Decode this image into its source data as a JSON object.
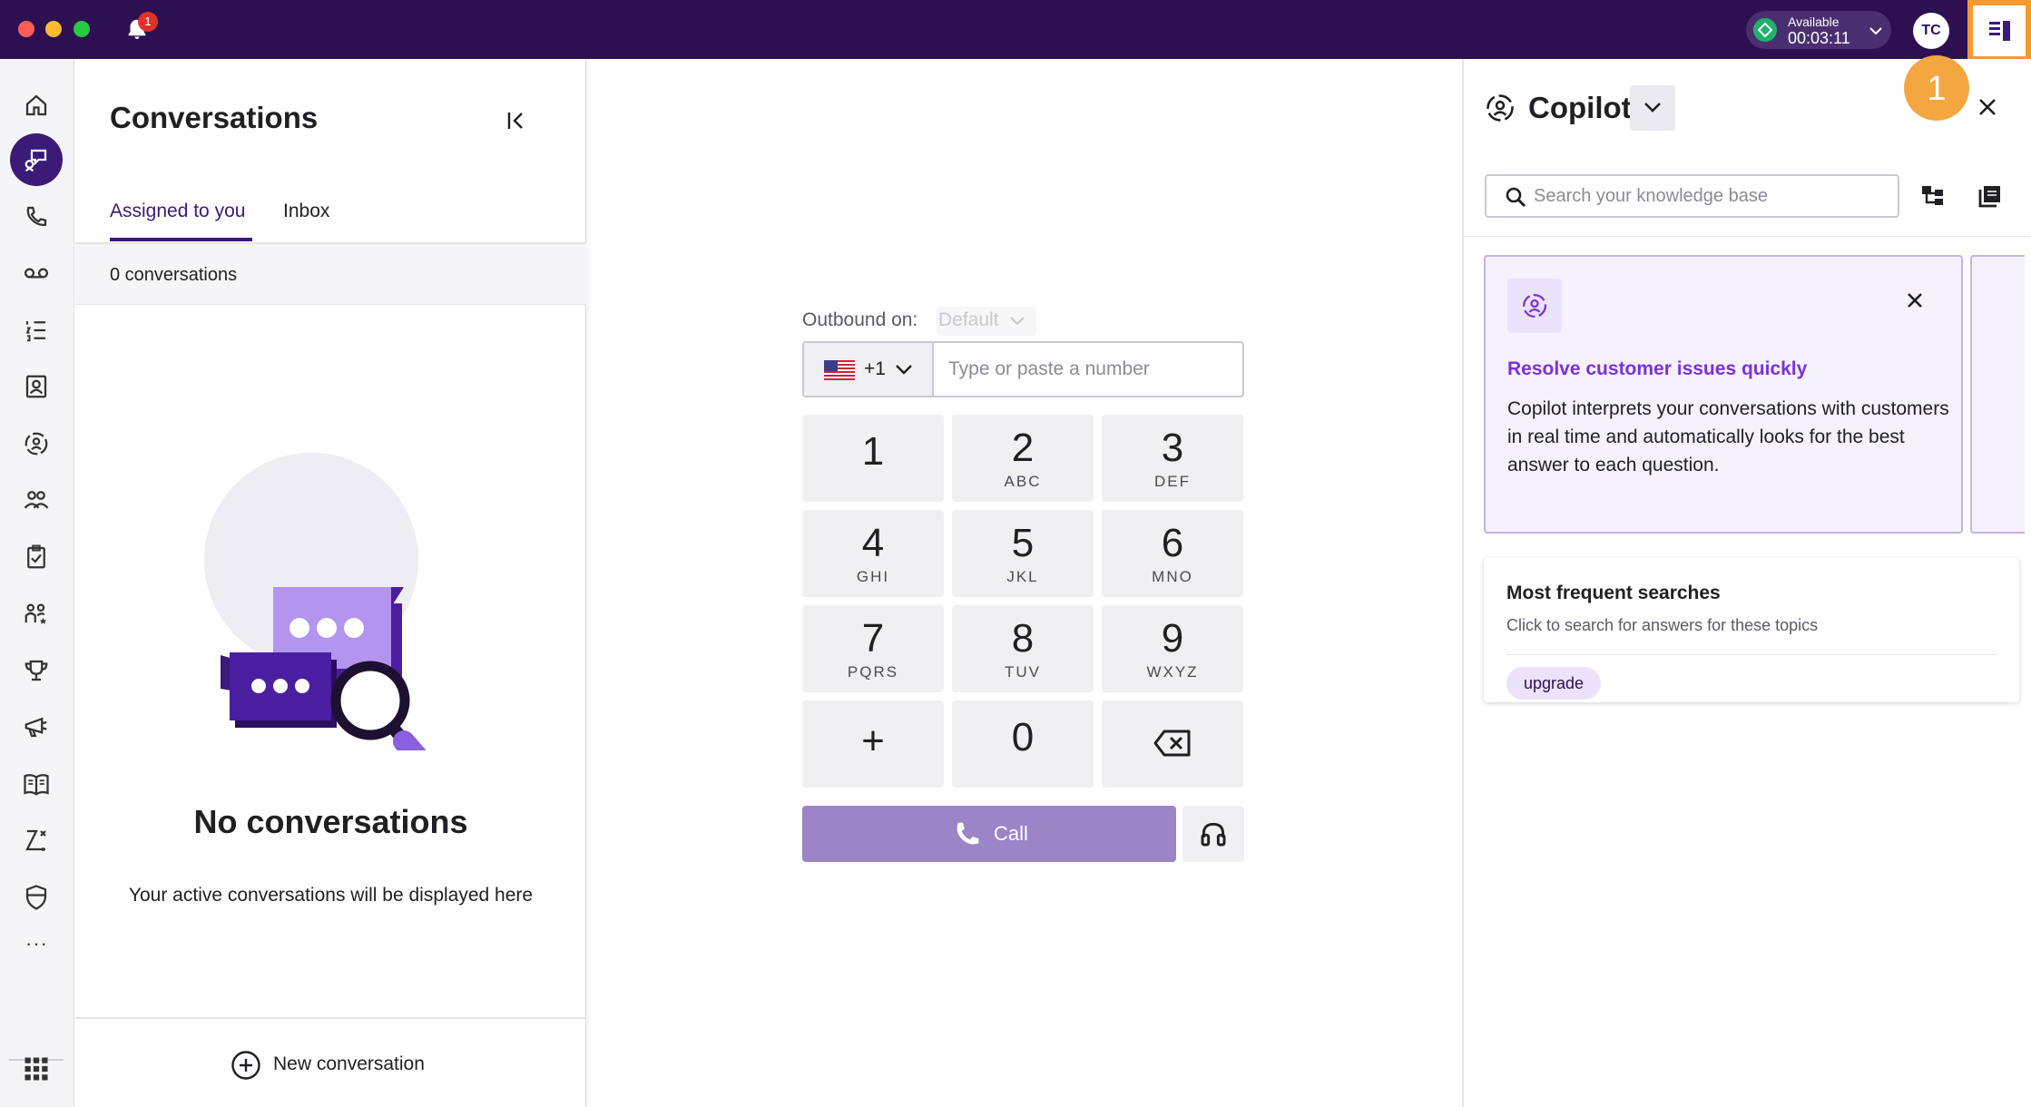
{
  "topbar": {
    "notification_count": "1",
    "status_label": "Available",
    "status_time": "00:03:11",
    "avatar_initials": "TC",
    "step_number": "1",
    "colors": {
      "background": "#2c1052",
      "highlight": "#f49a2c",
      "status": "#1fb26b"
    }
  },
  "rail": {
    "items": [
      "home-icon",
      "conversations-icon",
      "calls-icon",
      "voicemail-icon",
      "queue-list-icon",
      "contacts-icon",
      "copilot-icon",
      "team-icon",
      "tasks-icon",
      "agents-icon",
      "trophy-icon",
      "campaigns-icon",
      "knowledge-book-icon",
      "workflows-icon",
      "security-shield-icon"
    ],
    "more_label": "···",
    "apps_icon": "apps-grid-icon"
  },
  "conversations": {
    "title": "Conversations",
    "tabs": [
      "Assigned to you",
      "Inbox"
    ],
    "count_text": "0 conversations",
    "empty_title": "No conversations",
    "empty_subtitle": "Your active conversations will be displayed here",
    "new_conversation_label": "New conversation"
  },
  "dialer": {
    "outbound_label": "Outbound on:",
    "outbound_value": "Default",
    "country_code": "+1",
    "phone_placeholder": "Type or paste a number",
    "keys": [
      {
        "num": "1",
        "letters": ""
      },
      {
        "num": "2",
        "letters": "ABC"
      },
      {
        "num": "3",
        "letters": "DEF"
      },
      {
        "num": "4",
        "letters": "GHI"
      },
      {
        "num": "5",
        "letters": "JKL"
      },
      {
        "num": "6",
        "letters": "MNO"
      },
      {
        "num": "7",
        "letters": "PQRS"
      },
      {
        "num": "8",
        "letters": "TUV"
      },
      {
        "num": "9",
        "letters": "WXYZ"
      },
      {
        "num": "+",
        "letters": ""
      },
      {
        "num": "0",
        "letters": ""
      },
      {
        "num": "",
        "letters": ""
      }
    ],
    "call_label": "Call",
    "colors": {
      "call_button": "#9b85c7"
    }
  },
  "copilot": {
    "title": "Copilot",
    "search_placeholder": "Search your knowledge base",
    "tip": {
      "title": "Resolve customer issues quickly",
      "body": "Copilot interprets your conversations with customers in real time and automatically looks for the best answer to each question."
    },
    "frequent": {
      "title": "Most frequent searches",
      "subtitle": "Click to search for answers for these topics",
      "chips": [
        "upgrade"
      ]
    },
    "colors": {
      "accent": "#7a32d6",
      "card_bg": "#f5f1fd"
    }
  }
}
